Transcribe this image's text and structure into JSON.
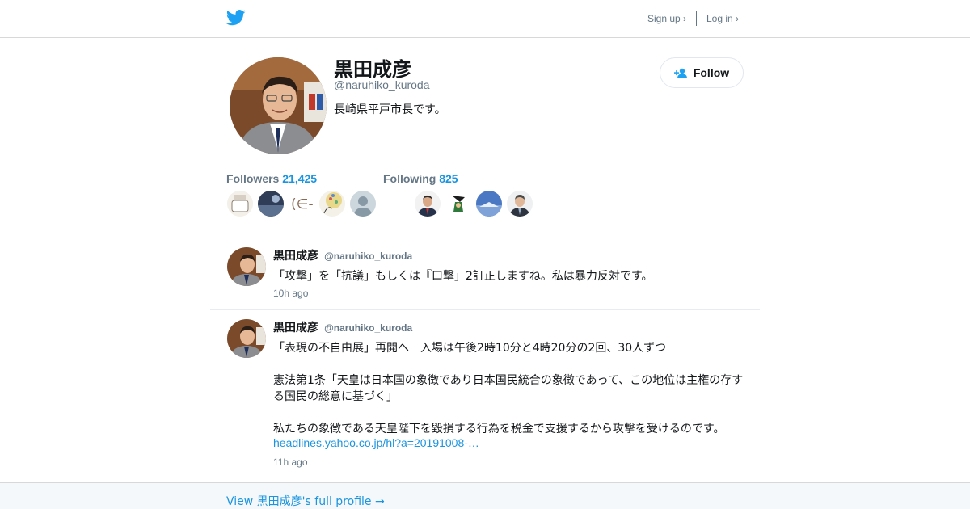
{
  "header": {
    "logo_icon": "twitter-bird-icon",
    "signup_label": "Sign up ›",
    "login_label": "Log in ›"
  },
  "profile": {
    "name": "黒田成彦",
    "handle": "@naruhiko_kuroda",
    "bio": "長崎県平戸市長です。",
    "follow_label": "Follow",
    "follow_icon": "add-person-icon",
    "followers_label": "Followers",
    "followers_count": "21,425",
    "following_label": "Following",
    "following_count": "825"
  },
  "tweets": [
    {
      "name": "黒田成彦",
      "handle": "@naruhiko_kuroda",
      "lines": [
        "「攻撃」を「抗議」もしくは『口撃」2訂正しますね。私は暴力反対です。"
      ],
      "time": "10h ago"
    },
    {
      "name": "黒田成彦",
      "handle": "@naruhiko_kuroda",
      "lines": [
        "「表現の不自由展」再開へ　入場は午後2時10分と4時20分の2回、30人ずつ",
        "憲法第1条「天皇は日本国の象徴であり日本国民統合の象徴であって、この地位は主権の存す",
        "る国民の総意に基づく」",
        "私たちの象徴である天皇陛下を毀損する行為を税金で支援するから攻撃を受けるのです。"
      ],
      "link": "headlines.yahoo.co.jp/hl?a=20191008-…",
      "time": "11h ago"
    }
  ],
  "footer": {
    "link_label": "View 黒田成彦's full profile →"
  },
  "colors": {
    "brand": "#1da1f2",
    "link": "#1b95e0",
    "muted": "#657786",
    "text": "#14171a",
    "footer_bg": "#f5f8fa"
  }
}
